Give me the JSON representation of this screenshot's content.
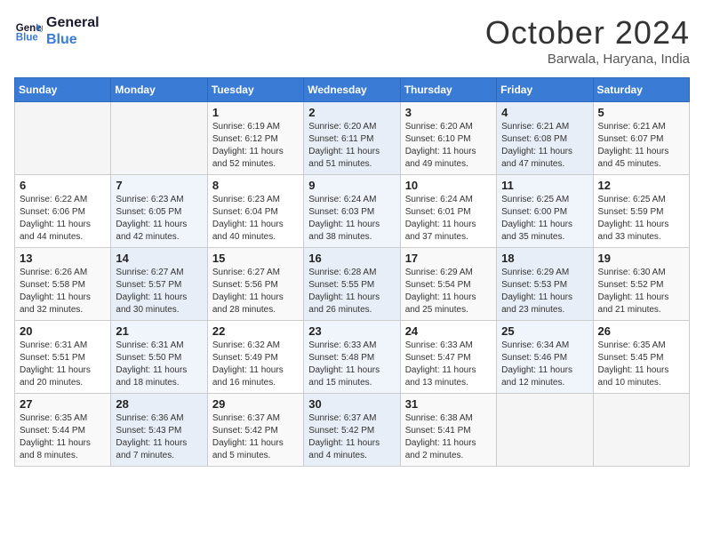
{
  "header": {
    "logo_line1": "General",
    "logo_line2": "Blue",
    "month": "October 2024",
    "location": "Barwala, Haryana, India"
  },
  "days_of_week": [
    "Sunday",
    "Monday",
    "Tuesday",
    "Wednesday",
    "Thursday",
    "Friday",
    "Saturday"
  ],
  "weeks": [
    [
      {
        "day": "",
        "info": ""
      },
      {
        "day": "",
        "info": ""
      },
      {
        "day": "1",
        "info": "Sunrise: 6:19 AM\nSunset: 6:12 PM\nDaylight: 11 hours\nand 52 minutes."
      },
      {
        "day": "2",
        "info": "Sunrise: 6:20 AM\nSunset: 6:11 PM\nDaylight: 11 hours\nand 51 minutes."
      },
      {
        "day": "3",
        "info": "Sunrise: 6:20 AM\nSunset: 6:10 PM\nDaylight: 11 hours\nand 49 minutes."
      },
      {
        "day": "4",
        "info": "Sunrise: 6:21 AM\nSunset: 6:08 PM\nDaylight: 11 hours\nand 47 minutes."
      },
      {
        "day": "5",
        "info": "Sunrise: 6:21 AM\nSunset: 6:07 PM\nDaylight: 11 hours\nand 45 minutes."
      }
    ],
    [
      {
        "day": "6",
        "info": "Sunrise: 6:22 AM\nSunset: 6:06 PM\nDaylight: 11 hours\nand 44 minutes."
      },
      {
        "day": "7",
        "info": "Sunrise: 6:23 AM\nSunset: 6:05 PM\nDaylight: 11 hours\nand 42 minutes."
      },
      {
        "day": "8",
        "info": "Sunrise: 6:23 AM\nSunset: 6:04 PM\nDaylight: 11 hours\nand 40 minutes."
      },
      {
        "day": "9",
        "info": "Sunrise: 6:24 AM\nSunset: 6:03 PM\nDaylight: 11 hours\nand 38 minutes."
      },
      {
        "day": "10",
        "info": "Sunrise: 6:24 AM\nSunset: 6:01 PM\nDaylight: 11 hours\nand 37 minutes."
      },
      {
        "day": "11",
        "info": "Sunrise: 6:25 AM\nSunset: 6:00 PM\nDaylight: 11 hours\nand 35 minutes."
      },
      {
        "day": "12",
        "info": "Sunrise: 6:25 AM\nSunset: 5:59 PM\nDaylight: 11 hours\nand 33 minutes."
      }
    ],
    [
      {
        "day": "13",
        "info": "Sunrise: 6:26 AM\nSunset: 5:58 PM\nDaylight: 11 hours\nand 32 minutes."
      },
      {
        "day": "14",
        "info": "Sunrise: 6:27 AM\nSunset: 5:57 PM\nDaylight: 11 hours\nand 30 minutes."
      },
      {
        "day": "15",
        "info": "Sunrise: 6:27 AM\nSunset: 5:56 PM\nDaylight: 11 hours\nand 28 minutes."
      },
      {
        "day": "16",
        "info": "Sunrise: 6:28 AM\nSunset: 5:55 PM\nDaylight: 11 hours\nand 26 minutes."
      },
      {
        "day": "17",
        "info": "Sunrise: 6:29 AM\nSunset: 5:54 PM\nDaylight: 11 hours\nand 25 minutes."
      },
      {
        "day": "18",
        "info": "Sunrise: 6:29 AM\nSunset: 5:53 PM\nDaylight: 11 hours\nand 23 minutes."
      },
      {
        "day": "19",
        "info": "Sunrise: 6:30 AM\nSunset: 5:52 PM\nDaylight: 11 hours\nand 21 minutes."
      }
    ],
    [
      {
        "day": "20",
        "info": "Sunrise: 6:31 AM\nSunset: 5:51 PM\nDaylight: 11 hours\nand 20 minutes."
      },
      {
        "day": "21",
        "info": "Sunrise: 6:31 AM\nSunset: 5:50 PM\nDaylight: 11 hours\nand 18 minutes."
      },
      {
        "day": "22",
        "info": "Sunrise: 6:32 AM\nSunset: 5:49 PM\nDaylight: 11 hours\nand 16 minutes."
      },
      {
        "day": "23",
        "info": "Sunrise: 6:33 AM\nSunset: 5:48 PM\nDaylight: 11 hours\nand 15 minutes."
      },
      {
        "day": "24",
        "info": "Sunrise: 6:33 AM\nSunset: 5:47 PM\nDaylight: 11 hours\nand 13 minutes."
      },
      {
        "day": "25",
        "info": "Sunrise: 6:34 AM\nSunset: 5:46 PM\nDaylight: 11 hours\nand 12 minutes."
      },
      {
        "day": "26",
        "info": "Sunrise: 6:35 AM\nSunset: 5:45 PM\nDaylight: 11 hours\nand 10 minutes."
      }
    ],
    [
      {
        "day": "27",
        "info": "Sunrise: 6:35 AM\nSunset: 5:44 PM\nDaylight: 11 hours\nand 8 minutes."
      },
      {
        "day": "28",
        "info": "Sunrise: 6:36 AM\nSunset: 5:43 PM\nDaylight: 11 hours\nand 7 minutes."
      },
      {
        "day": "29",
        "info": "Sunrise: 6:37 AM\nSunset: 5:42 PM\nDaylight: 11 hours\nand 5 minutes."
      },
      {
        "day": "30",
        "info": "Sunrise: 6:37 AM\nSunset: 5:42 PM\nDaylight: 11 hours\nand 4 minutes."
      },
      {
        "day": "31",
        "info": "Sunrise: 6:38 AM\nSunset: 5:41 PM\nDaylight: 11 hours\nand 2 minutes."
      },
      {
        "day": "",
        "info": ""
      },
      {
        "day": "",
        "info": ""
      }
    ]
  ]
}
